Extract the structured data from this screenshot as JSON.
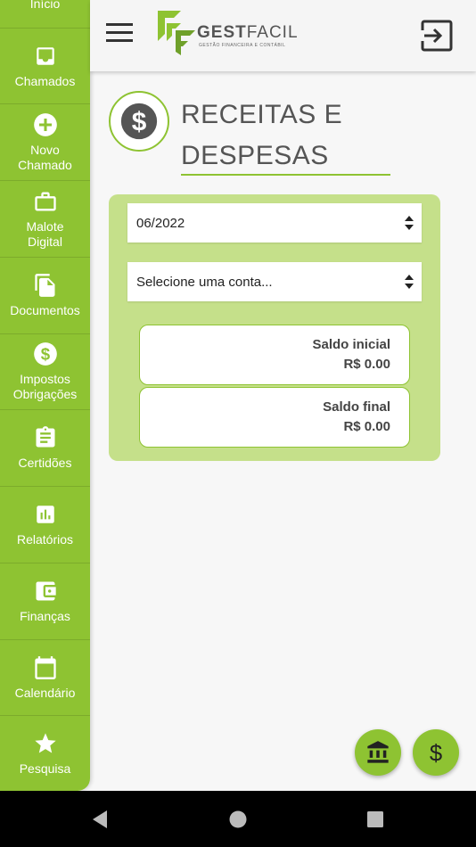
{
  "sidebar": {
    "items": [
      {
        "label": "Início",
        "icon": "home-icon"
      },
      {
        "label": "Chamados",
        "icon": "inbox-icon"
      },
      {
        "label": "Novo Chamado",
        "icon": "add-circle-icon"
      },
      {
        "label": "Malote Digital",
        "icon": "briefcase-icon"
      },
      {
        "label": "Documentos",
        "icon": "documents-icon"
      },
      {
        "label": "Impostos Obrigações",
        "icon": "dollar-circle-icon"
      },
      {
        "label": "Certidões",
        "icon": "clipboard-icon"
      },
      {
        "label": "Relatórios",
        "icon": "bar-chart-icon"
      },
      {
        "label": "Finanças",
        "icon": "wallet-icon"
      },
      {
        "label": "Calendário",
        "icon": "calendar-icon"
      },
      {
        "label": "Pesquisa",
        "icon": "star-icon"
      }
    ]
  },
  "header": {
    "logo_bold": "GEST",
    "logo_light": "FACIL",
    "logo_tagline": "GESTÃO FINANCEIRA E CONTÁBIL"
  },
  "page": {
    "title_line1": "RECEITAS E",
    "title_line2": "DESPESAS"
  },
  "filters": {
    "period_value": "06/2022",
    "account_placeholder": "Selecione uma conta..."
  },
  "balances": {
    "initial_label": "Saldo inicial",
    "initial_value": "R$ 0.00",
    "final_label": "Saldo final",
    "final_value": "R$ 0.00"
  },
  "colors": {
    "accent": "#8ec332",
    "card_bg": "#c5e08a"
  }
}
